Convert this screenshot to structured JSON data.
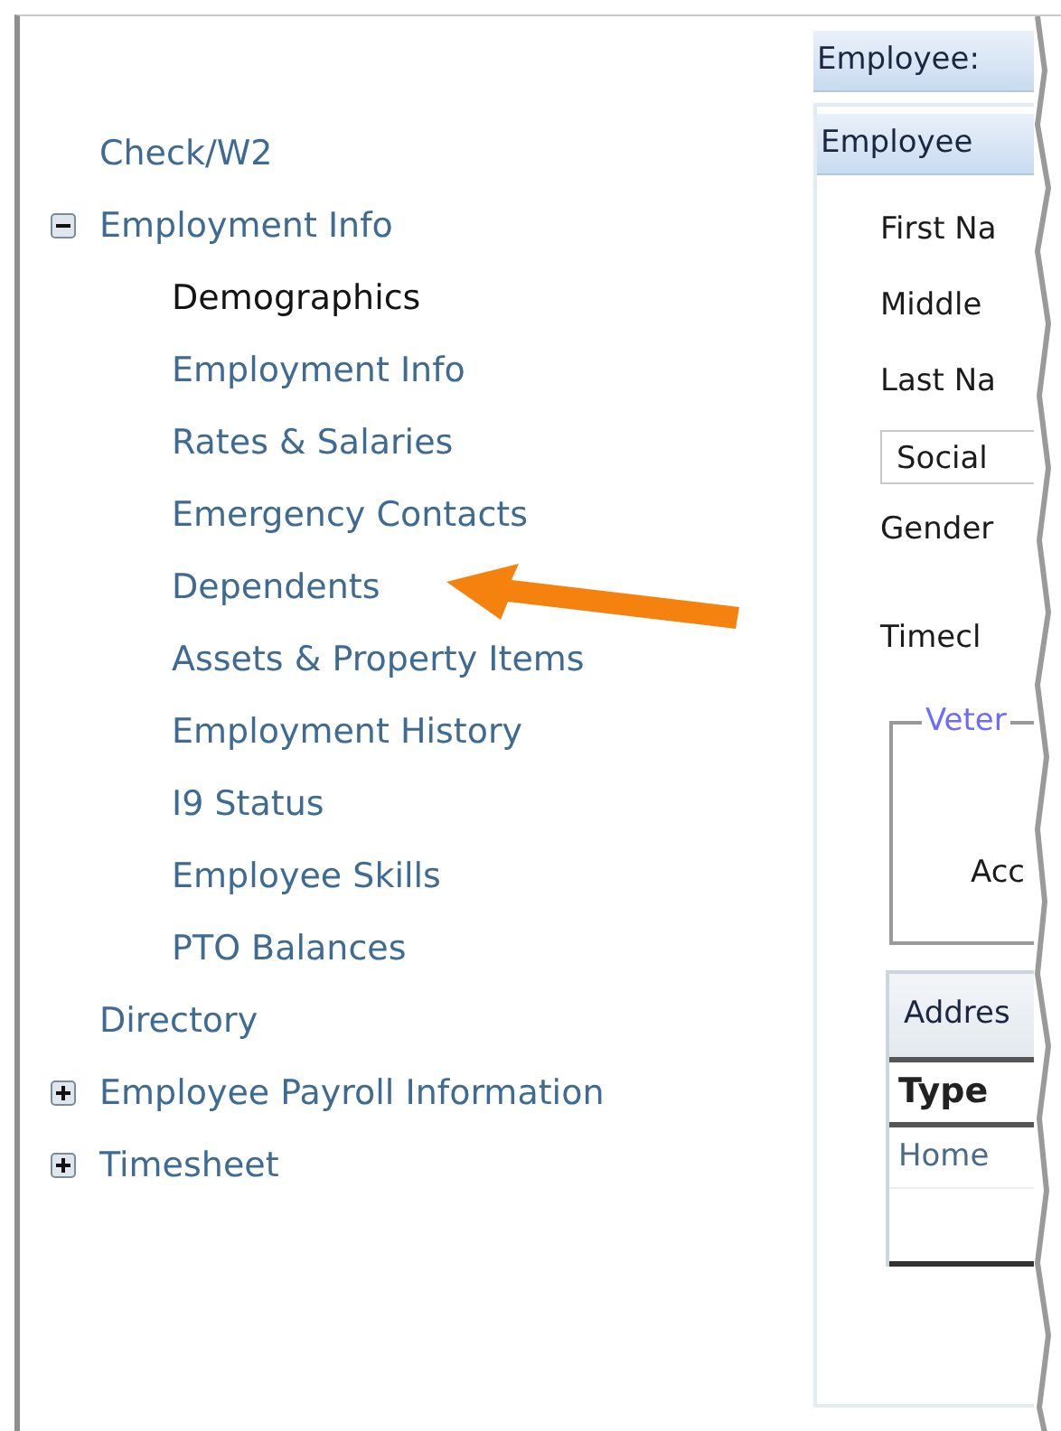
{
  "sidebar": {
    "items": [
      {
        "label": "Check/W2",
        "selected": false
      },
      {
        "label": "Employment Info",
        "expanded": true,
        "selected": false,
        "children": [
          {
            "label": "Demographics",
            "selected": true
          },
          {
            "label": "Employment Info",
            "selected": false
          },
          {
            "label": "Rates & Salaries",
            "selected": false
          },
          {
            "label": "Emergency Contacts",
            "selected": false
          },
          {
            "label": "Dependents",
            "selected": false
          },
          {
            "label": "Assets & Property Items",
            "selected": false
          },
          {
            "label": "Employment History",
            "selected": false
          },
          {
            "label": "I9 Status",
            "selected": false
          },
          {
            "label": "Employee Skills",
            "selected": false
          },
          {
            "label": "PTO Balances",
            "selected": false
          }
        ]
      },
      {
        "label": "Directory",
        "selected": false
      },
      {
        "label": "Employee Payroll Information",
        "expanded": false,
        "selected": false
      },
      {
        "label": "Timesheet",
        "expanded": false,
        "selected": false
      }
    ]
  },
  "panel": {
    "title": "Employee:",
    "section_title": "Employee",
    "fields": [
      {
        "kind": "label",
        "label": "First Na"
      },
      {
        "kind": "label",
        "label": "Middle"
      },
      {
        "kind": "label",
        "label": "Last Na"
      },
      {
        "kind": "boxed",
        "label": "Social"
      },
      {
        "kind": "label",
        "label": "Gender"
      },
      {
        "kind": "label",
        "label": "Timecl"
      }
    ],
    "fieldset": {
      "legend": "Veter",
      "label": "Acc"
    },
    "table": {
      "title": "Addres",
      "columns": [
        "Type"
      ],
      "rows": [
        [
          "Home"
        ]
      ]
    }
  }
}
